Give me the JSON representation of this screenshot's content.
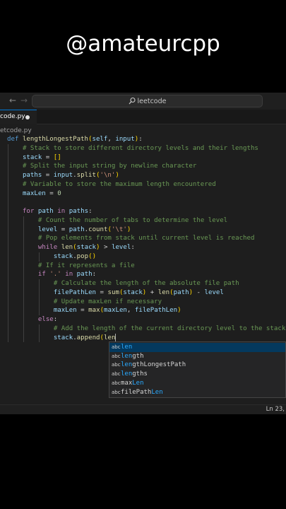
{
  "overlay": {
    "handle": "@amateurcpp"
  },
  "title_bar": {
    "back_icon": "←",
    "forward_icon": "→",
    "search_icon": "search-icon",
    "search_text": "leetcode"
  },
  "tab": {
    "label": "code.py"
  },
  "breadcrumb": {
    "text": "etcode.py"
  },
  "code_lines": [
    {
      "t": "def lengthLongestPath(self, input):"
    },
    {
      "t": "    # Stack to store different directory levels and their lengths"
    },
    {
      "t": "    stack = []"
    },
    {
      "t": "    # Split the input string by newline character"
    },
    {
      "t": "    paths = input.split('\\n')"
    },
    {
      "t": "    # Variable to store the maximum length encountered"
    },
    {
      "t": "    maxLen = 0"
    },
    {
      "t": ""
    },
    {
      "t": "    for path in paths:"
    },
    {
      "t": "        # Count the number of tabs to determine the level"
    },
    {
      "t": "        level = path.count('\\t')"
    },
    {
      "t": "        # Pop elements from stack until current level is reached"
    },
    {
      "t": "        while len(stack) > level:"
    },
    {
      "t": "            stack.pop()"
    },
    {
      "t": "        # If it represents a file"
    },
    {
      "t": "        if '.' in path:"
    },
    {
      "t": "            # Calculate the length of the absolute file path"
    },
    {
      "t": "            filePathLen = sum(stack) + len(path) - level"
    },
    {
      "t": "            # Update maxLen if necessary"
    },
    {
      "t": "            maxLen = max(maxLen, filePathLen)"
    },
    {
      "t": "        else:"
    },
    {
      "t": "            # Add the length of the current directory level to the stack"
    },
    {
      "t": "            stack.append(len"
    }
  ],
  "suggestions": [
    {
      "icon": "abc",
      "label": "len",
      "match": "len",
      "rest": "",
      "selected": true
    },
    {
      "icon": "abc",
      "label": "length",
      "match": "len",
      "rest": "gth",
      "selected": false
    },
    {
      "icon": "abc",
      "label": "lengthLongestPath",
      "match": "len",
      "rest": "gthLongestPath",
      "selected": false
    },
    {
      "icon": "abc",
      "label": "lengths",
      "match": "len",
      "rest": "gths",
      "selected": false
    },
    {
      "icon": "abc",
      "label": "maxLen",
      "prefix": "max",
      "match": "Len",
      "selected": false
    },
    {
      "icon": "abc",
      "label": "filePathLen",
      "prefix": "filePath",
      "match": "Len",
      "selected": false
    }
  ],
  "status_bar": {
    "position": "Ln 23,"
  },
  "colors": {
    "keyword": "#569cd6",
    "control": "#c586c0",
    "function": "#dcdcaa",
    "variable": "#9cdcfe",
    "string": "#ce9178",
    "number": "#b5cea8",
    "comment": "#6a9955",
    "suggest_highlight": "#2aaaff"
  }
}
